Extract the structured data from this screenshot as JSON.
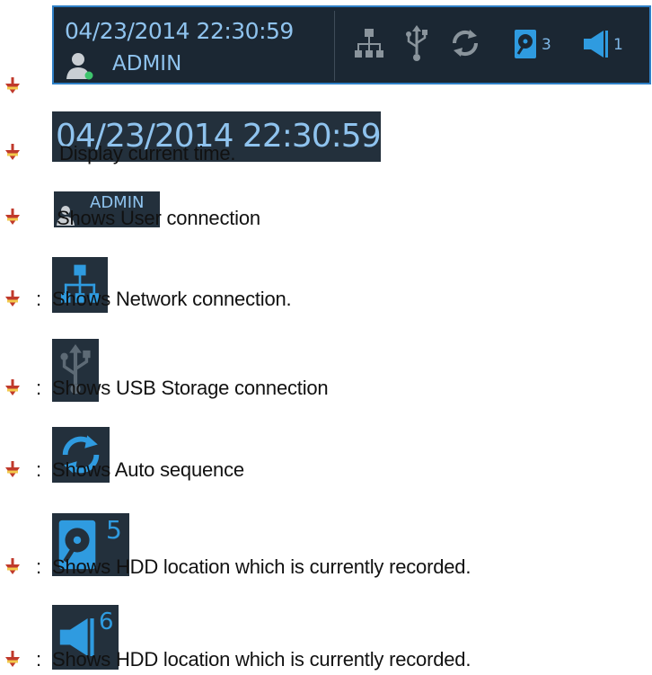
{
  "status_bar": {
    "datetime": "04/23/2014 22:30:59",
    "user": "ADMIN",
    "hdd_count": "3",
    "audio_count": "1"
  },
  "legend": {
    "colon": ":",
    "time_sample": "04/23/2014 22:30:59",
    "user_sample": "ADMIN",
    "hdd_sample_count": "5",
    "audio_sample_count": "6",
    "items": [
      {
        "text": "Display current time."
      },
      {
        "text": "Shows User connection"
      },
      {
        "text": "Shows Network connection."
      },
      {
        "text": "Shows USB Storage connection"
      },
      {
        "text": "Shows Auto sequence"
      },
      {
        "text": "Shows HDD location which is currently recorded."
      },
      {
        "text": "Shows HDD location which is currently recorded."
      }
    ]
  },
  "colors": {
    "bar_background": "#1b2733",
    "bar_border": "#2e7fc6",
    "icon_blue": "#2f9be0",
    "icon_gray": "#8a949c",
    "bullet_red": "#c0392b",
    "bullet_yellow": "#f2c94c"
  },
  "icons": [
    "user-icon",
    "network-icon",
    "usb-icon",
    "auto-sequence-icon",
    "hdd-icon",
    "speaker-icon",
    "bullet-arrow-icon"
  ]
}
